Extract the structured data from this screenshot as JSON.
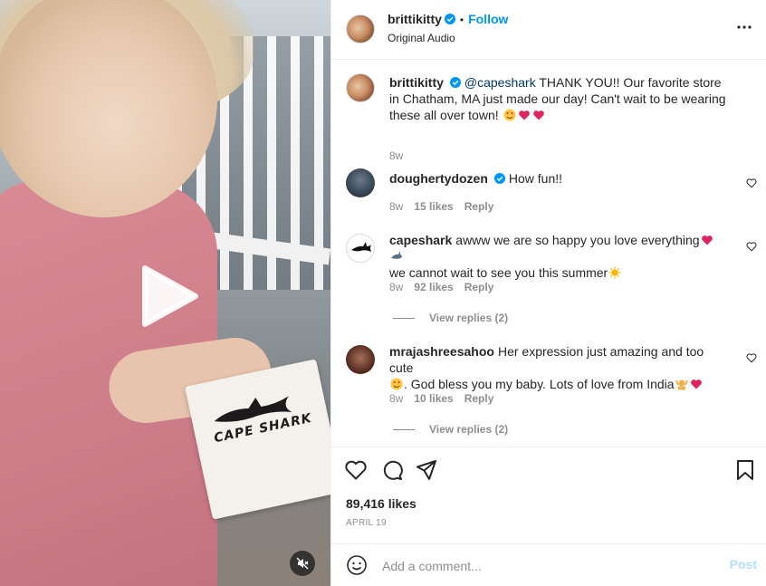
{
  "post": {
    "author": "brittikitty",
    "follow_label": "Follow",
    "separator": "•",
    "audio": "Original Audio",
    "caption": {
      "username": "brittikitty",
      "mention": "@capeshark",
      "text": "THANK YOU!! Our favorite store in Chatham, MA just made our day! Can't wait to be wearing these all over town!",
      "time": "8w"
    },
    "media": {
      "bag_text": "CAPE SHARK",
      "play_icon": "play-icon",
      "mute_icon": "speaker-muted-icon"
    }
  },
  "comments": [
    {
      "username": "doughertydozen",
      "text": "How fun!!",
      "time": "8w",
      "likes": "15 likes",
      "reply": "Reply"
    },
    {
      "username": "capeshark",
      "text_line1": "awww we are so happy you love everything",
      "text_line2": "we cannot wait to see you this summer",
      "time": "8w",
      "likes": "92 likes",
      "reply": "Reply",
      "view_replies": "View replies (2)"
    },
    {
      "username": "mrajashreesahoo",
      "text_line1": "Her expression just amazing and too cute",
      "text_line2": ". God bless you my baby. Lots of love from India",
      "time": "8w",
      "likes": "10 likes",
      "reply": "Reply",
      "view_replies": "View replies (2)"
    }
  ],
  "footer": {
    "likes": "89,416 likes",
    "date": "APRIL 19",
    "comment_placeholder": "Add a comment...",
    "post_label": "Post"
  },
  "colors": {
    "accent": "#0095f6",
    "verified": "#0095f6",
    "heart": "#ed4956",
    "muted_text": "#8e8e8e",
    "post_disabled": "#b2dffc"
  },
  "icons": [
    "verified-badge-icon",
    "more-options-icon",
    "heart-icon",
    "comment-icon",
    "share-icon",
    "save-icon",
    "emoji-icon"
  ]
}
